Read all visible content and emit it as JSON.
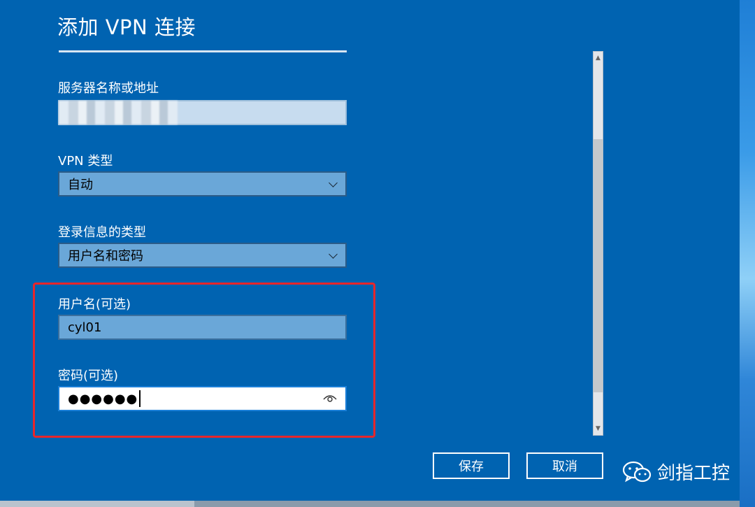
{
  "dialog": {
    "title": "添加 VPN 连接"
  },
  "fields": {
    "server": {
      "label": "服务器名称或地址",
      "value": ""
    },
    "vpn_type": {
      "label": "VPN 类型",
      "selected": "自动"
    },
    "signin_type": {
      "label": "登录信息的类型",
      "selected": "用户名和密码"
    },
    "username": {
      "label": "用户名(可选)",
      "value": "cyl01"
    },
    "password": {
      "label": "密码(可选)",
      "masked_value": "●●●●●●"
    }
  },
  "buttons": {
    "save": "保存",
    "cancel": "取消"
  },
  "watermark": {
    "text": "剑指工控"
  },
  "colors": {
    "background": "#0063b1",
    "highlight_border": "#e8262b"
  },
  "icons": {
    "password_reveal": "eye-icon",
    "dropdown": "chevron-down-icon",
    "watermark": "wechat-icon"
  }
}
